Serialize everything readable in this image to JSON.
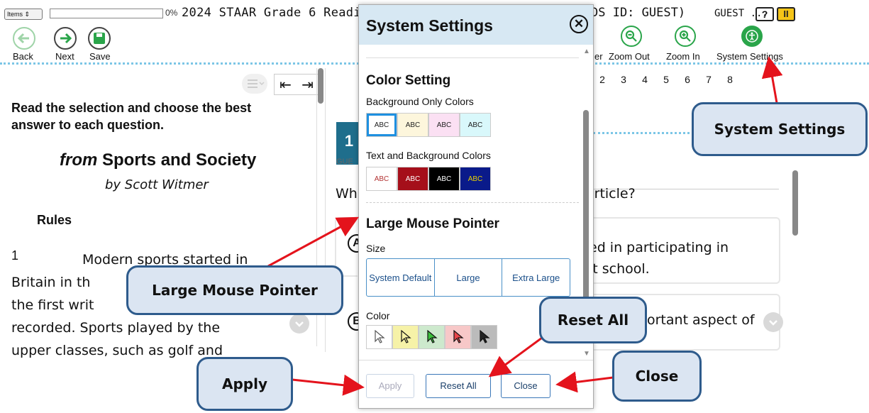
{
  "topbar": {
    "items_label": "Items",
    "progress_pct": "0%",
    "title_left": "2024 STAAR Grade 6 Readin",
    "title_right": "DS ID: GUEST)",
    "guest": "GUEST ...",
    "help_label": "?",
    "pause_label": "II"
  },
  "toolbar": {
    "back": "Back",
    "next": "Next",
    "save": "Save",
    "partial_label": "er",
    "zoom_out": "Zoom Out",
    "zoom_in": "Zoom In",
    "system_settings": "System Settings"
  },
  "passage": {
    "instructions": "Read the selection and choose the best answer to each question.",
    "title_prefix": "from",
    "title": "Sports and Society",
    "author": "by Scott Witmer",
    "heading": "Rules",
    "para_num": "1",
    "para_lines": [
      "Modern sports started in",
      "Britain in th",
      "the first writ",
      "recorded. Sports played by the",
      "upper classes, such as golf and"
    ]
  },
  "question": {
    "numbers": [
      "2",
      "3",
      "4",
      "5",
      "6",
      "7",
      "8"
    ],
    "current": "1",
    "guest_label": "GUE",
    "stem_start": "Wh",
    "stem_end": "article?",
    "choice_a_letter": "A",
    "choice_a_line1": "ed in participating in",
    "choice_a_line2": "it school.",
    "choice_b_letter": "B",
    "choice_b_text": "ortant aspect of"
  },
  "modal": {
    "title": "System Settings",
    "close_icon": "⊗",
    "color_setting": "Color Setting",
    "bg_only": "Background Only Colors",
    "bg_swatches": [
      {
        "label": "ABC",
        "bg": "#ffffff",
        "fg": "#222222"
      },
      {
        "label": "ABC",
        "bg": "#fdf6dc",
        "fg": "#222222"
      },
      {
        "label": "ABC",
        "bg": "#fbe0f3",
        "fg": "#222222"
      },
      {
        "label": "ABC",
        "bg": "#d9f8fb",
        "fg": "#222222"
      }
    ],
    "text_bg": "Text and Background Colors",
    "tb_swatches": [
      {
        "label": "ABC",
        "bg": "#ffffff",
        "fg": "#b33333"
      },
      {
        "label": "ABC",
        "bg": "#a50f1a",
        "fg": "#ffffff"
      },
      {
        "label": "ABC",
        "bg": "#000000",
        "fg": "#ffffff"
      },
      {
        "label": "ABC",
        "bg": "#0a1a8a",
        "fg": "#e8d000"
      }
    ],
    "large_mouse_pointer": "Large Mouse Pointer",
    "size_label": "Size",
    "size_options": [
      "System Default",
      "Large",
      "Extra Large"
    ],
    "color_label": "Color",
    "cursor_colors": [
      "#ffffff",
      "#f6f2a8",
      "#3bbf3b",
      "#e8454a",
      "#222222"
    ],
    "apply": "Apply",
    "reset_all": "Reset All",
    "close": "Close"
  },
  "callouts": {
    "system_settings": "System Settings",
    "large_mouse_pointer": "Large Mouse Pointer",
    "reset_all": "Reset All",
    "apply": "Apply",
    "close": "Close"
  },
  "colors": {
    "accent": "#2e5b8c",
    "arrow": "#e4131c",
    "nav_green": "#2aa54a"
  }
}
